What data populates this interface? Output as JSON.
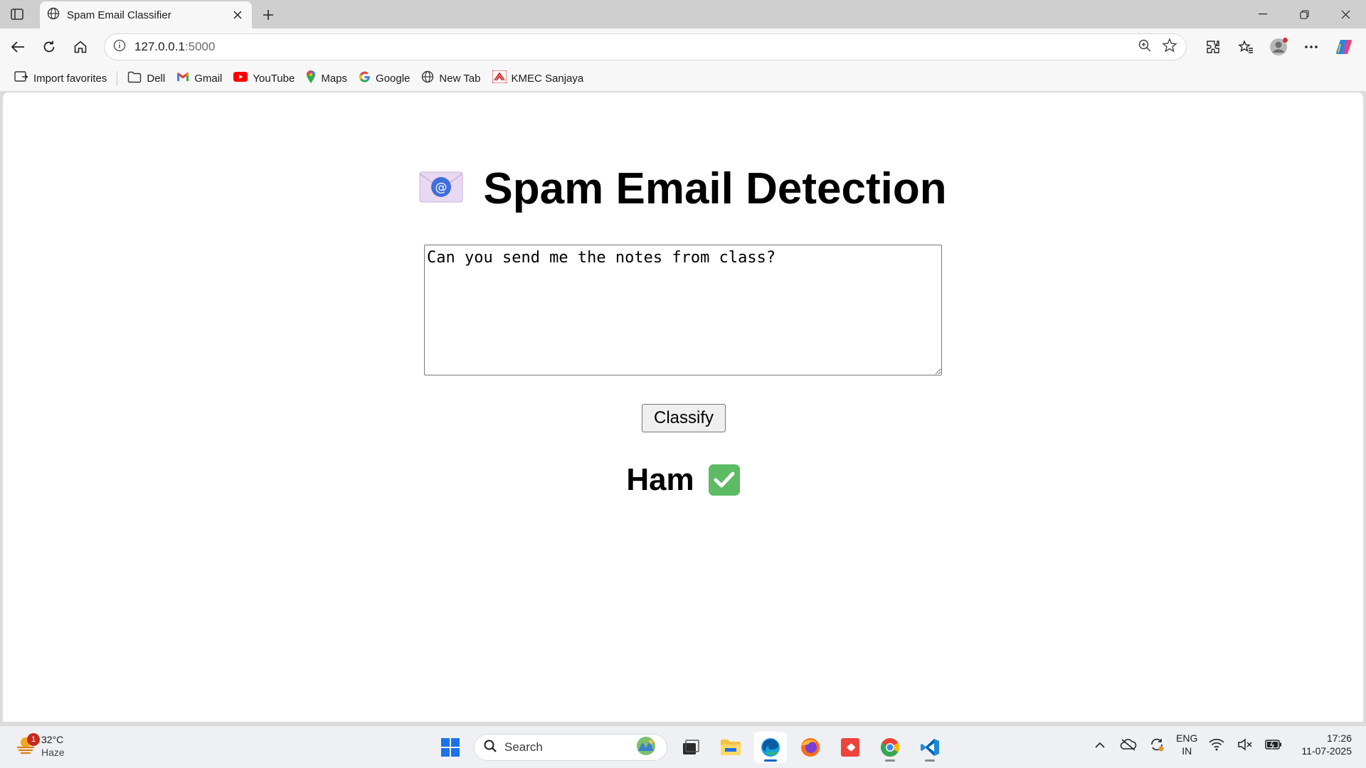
{
  "browser": {
    "tab_title": "Spam Email Classifier",
    "url_host": "127.0.0.1",
    "url_port": ":5000",
    "bookmarks": [
      {
        "label": "Import favorites",
        "icon": "import-icon"
      },
      {
        "label": "Dell",
        "icon": "folder-icon"
      },
      {
        "label": "Gmail",
        "icon": "gmail-icon"
      },
      {
        "label": "YouTube",
        "icon": "youtube-icon"
      },
      {
        "label": "Maps",
        "icon": "maps-icon"
      },
      {
        "label": "Google",
        "icon": "google-icon"
      },
      {
        "label": "New Tab",
        "icon": "globe-icon"
      },
      {
        "label": "KMEC Sanjaya",
        "icon": "kmec-icon"
      }
    ]
  },
  "page": {
    "title": "Spam Email Detection",
    "title_icon": "email-icon",
    "message_value": "Can you send me the notes from class?",
    "classify_label": "Classify",
    "result_text": "Ham",
    "result_icon": "check-mark-icon",
    "result_color": "#5dbb63"
  },
  "taskbar": {
    "weather_temp": "32°C",
    "weather_desc": "Haze",
    "weather_badge": "1",
    "search_label": "Search",
    "lang_top": "ENG",
    "lang_bottom": "IN",
    "time": "17:26",
    "date": "11-07-2025"
  },
  "colors": {
    "accent": "#0067c0",
    "page_bg": "#ffffff"
  }
}
